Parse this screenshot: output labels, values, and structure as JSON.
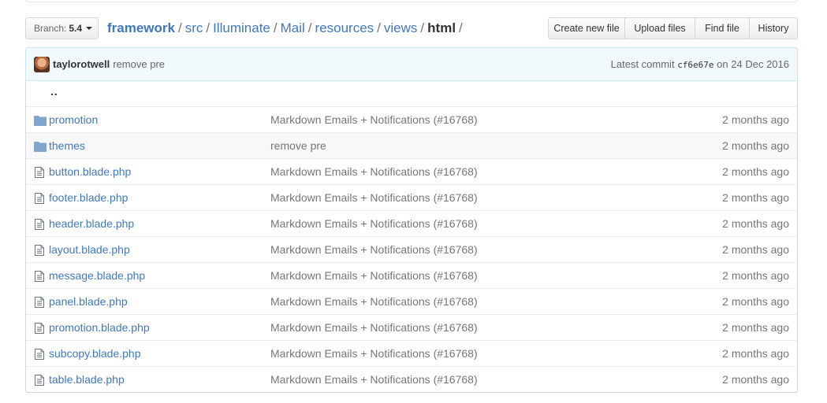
{
  "nav": {
    "branch_label": "Branch:",
    "branch_value": "5.4",
    "breadcrumb": [
      "framework",
      "src",
      "Illuminate",
      "Mail",
      "resources",
      "views"
    ],
    "current_dir": "html",
    "trailing_sep": "/",
    "separator": "/",
    "buttons": [
      "Create new file",
      "Upload files",
      "Find file",
      "History"
    ]
  },
  "commit": {
    "author": "taylorotwell",
    "message": "remove pre",
    "latest_label": "Latest commit",
    "sha": "cf6e67e",
    "on_label": "on",
    "date": "24 Dec 2016"
  },
  "up_link": "..",
  "files": [
    {
      "name": "promotion",
      "type": "folder-icon",
      "message": "Markdown Emails + Notifications (#16768)",
      "age": "2 months ago"
    },
    {
      "name": "themes",
      "type": "folder-icon",
      "message": "remove pre",
      "age": "2 months ago"
    },
    {
      "name": "button.blade.php",
      "type": "file-icon",
      "message": "Markdown Emails + Notifications (#16768)",
      "age": "2 months ago"
    },
    {
      "name": "footer.blade.php",
      "type": "file-icon",
      "message": "Markdown Emails + Notifications (#16768)",
      "age": "2 months ago"
    },
    {
      "name": "header.blade.php",
      "type": "file-icon",
      "message": "Markdown Emails + Notifications (#16768)",
      "age": "2 months ago"
    },
    {
      "name": "layout.blade.php",
      "type": "file-icon",
      "message": "Markdown Emails + Notifications (#16768)",
      "age": "2 months ago"
    },
    {
      "name": "message.blade.php",
      "type": "file-icon",
      "message": "Markdown Emails + Notifications (#16768)",
      "age": "2 months ago"
    },
    {
      "name": "panel.blade.php",
      "type": "file-icon",
      "message": "Markdown Emails + Notifications (#16768)",
      "age": "2 months ago"
    },
    {
      "name": "promotion.blade.php",
      "type": "file-icon",
      "message": "Markdown Emails + Notifications (#16768)",
      "age": "2 months ago"
    },
    {
      "name": "subcopy.blade.php",
      "type": "file-icon",
      "message": "Markdown Emails + Notifications (#16768)",
      "age": "2 months ago"
    },
    {
      "name": "table.blade.php",
      "type": "file-icon",
      "message": "Markdown Emails + Notifications (#16768)",
      "age": "2 months ago"
    }
  ],
  "colors": {
    "link": "#4078c0",
    "folder": "#80a6cd",
    "commit_bg": "#f2f9fc"
  }
}
